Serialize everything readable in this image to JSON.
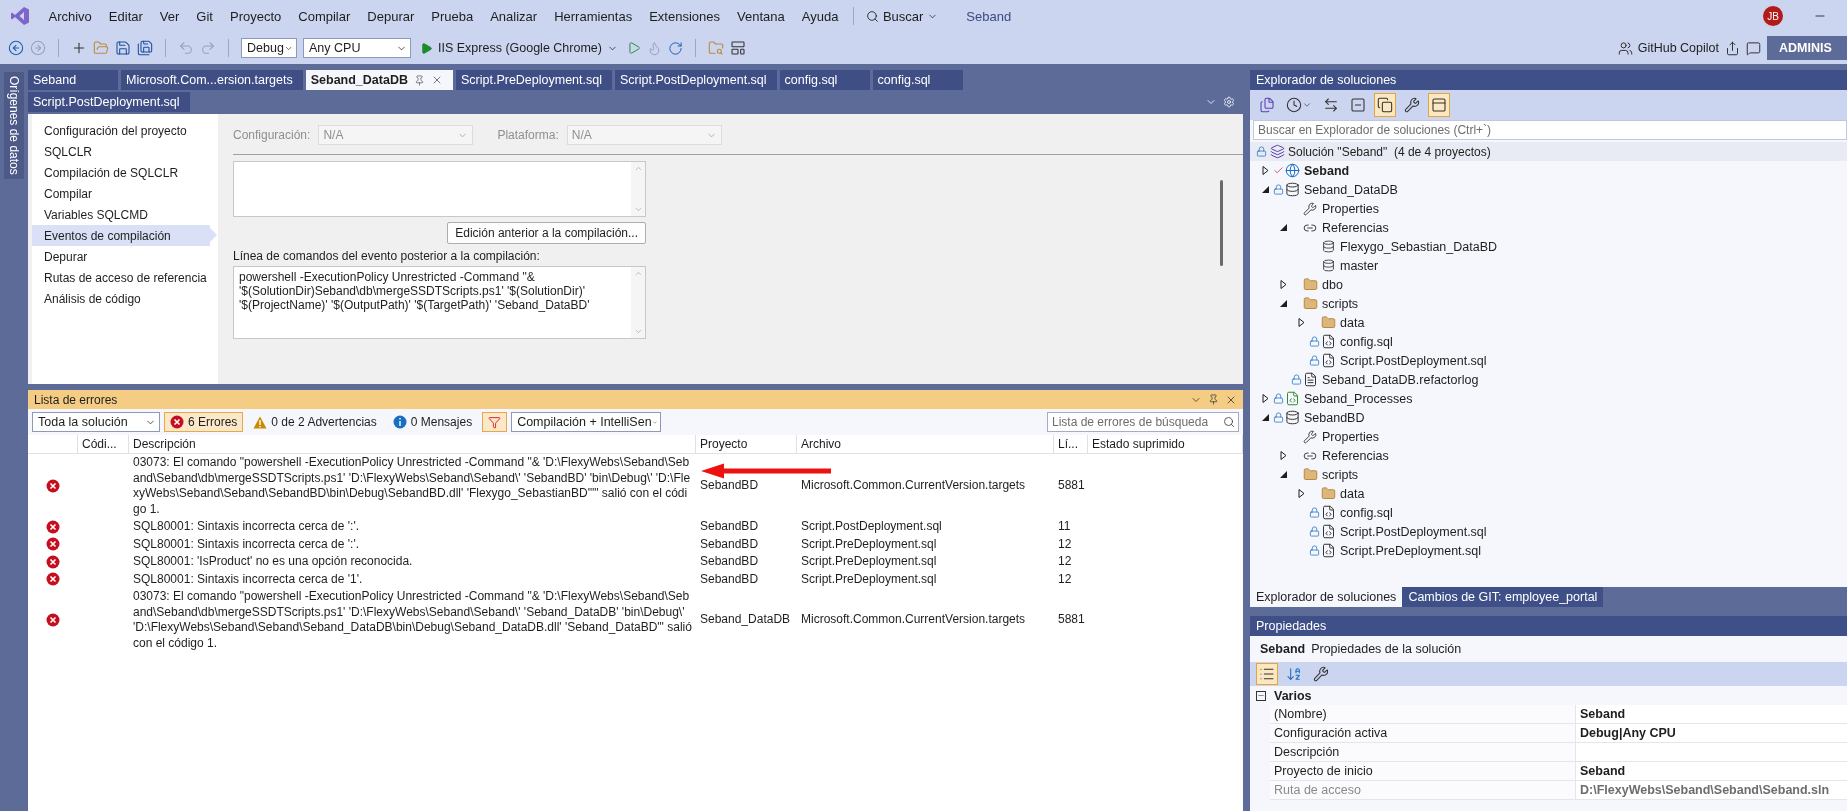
{
  "menu": {
    "items": [
      "Archivo",
      "Editar",
      "Ver",
      "Git",
      "Proyecto",
      "Compilar",
      "Depurar",
      "Prueba",
      "Analizar",
      "Herramientas",
      "Extensiones",
      "Ventana",
      "Ayuda"
    ],
    "search": "Buscar",
    "title": "Seband",
    "avatar": "JB"
  },
  "toolbar": {
    "configuration": "Debug",
    "platform": "Any CPU",
    "run_target": "IIS Express (Google Chrome)",
    "copilot": "GitHub Copilot",
    "account": "ADMINIS"
  },
  "side_strip": {
    "label": "Orígenes de datos"
  },
  "document_tabs": [
    [
      {
        "label": "Seband",
        "selected": false
      },
      {
        "label": "Microsoft.Com...ersion.targets",
        "selected": false
      },
      {
        "label": "Seband_DataDB",
        "selected": true
      },
      {
        "label": "Script.PreDeployment.sql",
        "selected": false
      },
      {
        "label": "Script.PostDeployment.sql",
        "selected": false
      },
      {
        "label": "config.sql",
        "selected": false
      },
      {
        "label": "config.sql",
        "selected": false
      }
    ],
    [
      {
        "label": "Script.PostDeployment.sql",
        "selected": false
      }
    ]
  ],
  "project_properties": {
    "nav": [
      {
        "label": "Configuración del proyecto",
        "selected": false
      },
      {
        "label": "SQLCLR",
        "selected": false
      },
      {
        "label": "Compilación de SQLCLR",
        "selected": false
      },
      {
        "label": "Compilar",
        "selected": false
      },
      {
        "label": "Variables SQLCMD",
        "selected": false
      },
      {
        "label": "Eventos de compilación",
        "selected": true
      },
      {
        "label": "Depurar",
        "selected": false
      },
      {
        "label": "Rutas de acceso de referencia",
        "selected": false
      },
      {
        "label": "Análisis de código",
        "selected": false
      }
    ],
    "configuration_label": "Configuración:",
    "configuration": "N/A",
    "platform_label": "Plataforma:",
    "platform": "N/A",
    "pre_build_button": "Edición anterior a la compilación...",
    "post_build_label": "Línea de comandos del evento posterior a la compilación:",
    "post_build_command": "powershell -ExecutionPolicy Unrestricted -Command \"& '$(SolutionDir)Seband\\db\\mergeSSDTScripts.ps1' '$(SolutionDir)' '$(ProjectName)' '$(OutputPath)' '$(TargetPath)' 'Seband_DataBD'"
  },
  "error_list": {
    "title": "Lista de errores",
    "scope": "Toda la solución",
    "filters": [
      {
        "kind": "error",
        "label": "6 Errores",
        "selected": true
      },
      {
        "kind": "warning",
        "label": "0 de 2 Advertencias",
        "selected": false
      },
      {
        "kind": "info",
        "label": "0 Mensajes",
        "selected": false
      }
    ],
    "filter_button": {
      "selected": true
    },
    "source": "Compilación + IntelliSen",
    "search_placeholder": "Lista de errores de búsqueda",
    "columns": [
      "Códi...",
      "Descripción",
      "Proyecto",
      "Archivo",
      "Lí...",
      "Estado suprimido"
    ],
    "rows": [
      {
        "kind": "error",
        "description": "03073: El comando \"powershell -ExecutionPolicy Unrestricted -Command \"& 'D:\\FlexyWebs\\Seband\\Seband\\Seband\\db\\mergeSSDTScripts.ps1' 'D:\\FlexyWebs\\Seband\\Seband\\' 'SebandBD' 'bin\\Debug\\' 'D:\\FlexyWebs\\Seband\\Seband\\SebandBD\\bin\\Debug\\SebandBD.dll' 'Flexygo_SebastianBD'\"\" salió con el código 1.",
        "project": "SebandBD",
        "file": "Microsoft.Common.CurrentVersion.targets",
        "line": "5881",
        "annotated": true
      },
      {
        "kind": "error",
        "description": "SQL80001: Sintaxis incorrecta cerca de ':'.",
        "project": "SebandBD",
        "file": "Script.PostDeployment.sql",
        "line": "11",
        "annotated": false
      },
      {
        "kind": "error",
        "description": "SQL80001: Sintaxis incorrecta cerca de ':'.",
        "project": "SebandBD",
        "file": "Script.PreDeployment.sql",
        "line": "12",
        "annotated": false
      },
      {
        "kind": "error",
        "description": "SQL80001: 'IsProduct' no es una opción reconocida.",
        "project": "SebandBD",
        "file": "Script.PreDeployment.sql",
        "line": "12",
        "annotated": false
      },
      {
        "kind": "error",
        "description": "SQL80001: Sintaxis incorrecta cerca de '1'.",
        "project": "SebandBD",
        "file": "Script.PreDeployment.sql",
        "line": "12",
        "annotated": false
      },
      {
        "kind": "error",
        "description": "03073: El comando \"powershell -ExecutionPolicy Unrestricted -Command \"& 'D:\\FlexyWebs\\Seband\\Seband\\Seband\\db\\mergeSSDTScripts.ps1' 'D:\\FlexyWebs\\Seband\\Seband\\' 'Seband_DataDB' 'bin\\Debug\\' 'D:\\FlexyWebs\\Seband\\Seband\\Seband_DataDB\\bin\\Debug\\Seband_DataDB.dll' 'Seband_DataBD'\" salió con el código 1.",
        "project": "Seband_DataDB",
        "file": "Microsoft.Common.CurrentVersion.targets",
        "line": "5881",
        "annotated": false
      }
    ]
  },
  "solution_explorer": {
    "title": "Explorador de soluciones",
    "toolbar": [
      {
        "kind": "switch-views",
        "selected": false
      },
      {
        "kind": "pending-changes",
        "selected": false
      },
      {
        "kind": "sync",
        "selected": false
      },
      {
        "kind": "collapse-all",
        "selected": false
      },
      {
        "kind": "show-all-files",
        "selected": true
      },
      {
        "kind": "properties",
        "selected": false
      },
      {
        "kind": "preview",
        "selected": true
      }
    ],
    "search_placeholder": "Buscar en Explorador de soluciones (Ctrl+`)",
    "solution": "Solución \"Seband\"  (4 de 4 proyectos)",
    "tree": [
      {
        "label": "Seband",
        "kind": "web-project",
        "edited": true,
        "locked": false,
        "startup": true,
        "expanded": false
      },
      {
        "label": "Seband_DataDB",
        "kind": "db-project",
        "edited": false,
        "locked": true,
        "startup": false,
        "expanded": true,
        "children": [
          {
            "label": "Properties",
            "kind": "properties",
            "edited": false,
            "locked": false
          },
          {
            "label": "Referencias",
            "kind": "references",
            "edited": false,
            "locked": false,
            "expanded": true,
            "children": [
              {
                "label": "Flexygo_Sebastian_DataBD",
                "kind": "reference",
                "edited": false,
                "locked": false
              },
              {
                "label": "master",
                "kind": "reference",
                "edited": false,
                "locked": false
              }
            ]
          },
          {
            "label": "dbo",
            "kind": "folder",
            "edited": false,
            "locked": false,
            "expanded": false
          },
          {
            "label": "scripts",
            "kind": "folder",
            "edited": false,
            "locked": false,
            "expanded": true,
            "children": [
              {
                "label": "data",
                "kind": "folder",
                "edited": false,
                "locked": false,
                "expanded": false
              },
              {
                "label": "config.sql",
                "kind": "sql",
                "edited": false,
                "locked": true
              },
              {
                "label": "Script.PostDeployment.sql",
                "kind": "sql",
                "edited": false,
                "locked": true
              }
            ]
          },
          {
            "label": "Seband_DataDB.refactorlog",
            "kind": "refactorlog",
            "edited": false,
            "locked": true
          }
        ]
      },
      {
        "label": "Seband_Processes",
        "kind": "csharp-project",
        "edited": false,
        "locked": true,
        "startup": false,
        "expanded": false
      },
      {
        "label": "SebandBD",
        "kind": "db-project",
        "edited": false,
        "locked": true,
        "startup": false,
        "expanded": true,
        "children": [
          {
            "label": "Properties",
            "kind": "properties",
            "edited": false,
            "locked": false
          },
          {
            "label": "Referencias",
            "kind": "references",
            "edited": false,
            "locked": false,
            "expanded": false
          },
          {
            "label": "scripts",
            "kind": "folder",
            "edited": false,
            "locked": false,
            "expanded": true,
            "children": [
              {
                "label": "data",
                "kind": "folder",
                "edited": false,
                "locked": false,
                "expanded": false
              },
              {
                "label": "config.sql",
                "kind": "sql",
                "edited": false,
                "locked": true
              },
              {
                "label": "Script.PostDeployment.sql",
                "kind": "sql",
                "edited": false,
                "locked": true
              },
              {
                "label": "Script.PreDeployment.sql",
                "kind": "sql",
                "edited": false,
                "locked": true
              }
            ]
          }
        ]
      }
    ],
    "bottom_tabs": [
      {
        "label": "Explorador de soluciones",
        "selected": true
      },
      {
        "label": "Cambios de GIT: employee_portal",
        "selected": false
      }
    ]
  },
  "properties": {
    "title": "Propiedades",
    "object_name": "Seband",
    "object_type": "Propiedades de la solución",
    "toolbar": [
      {
        "kind": "categorized",
        "selected": true
      },
      {
        "kind": "alphabetical",
        "selected": false
      },
      {
        "kind": "property-pages",
        "selected": false
      }
    ],
    "category": {
      "label": "Varios",
      "expanded": true
    },
    "rows": [
      {
        "name": "(Nombre)",
        "value": "Seband",
        "disabled": false
      },
      {
        "name": "Configuración activa",
        "value": "Debug|Any CPU",
        "disabled": false
      },
      {
        "name": "Descripción",
        "disabled": false
      },
      {
        "name": "Proyecto de inicio",
        "value": "Seband",
        "disabled": false
      },
      {
        "name": "Ruta de acceso",
        "value": "D:\\FlexyWebs\\Seband\\Seband\\Seband.sln",
        "disabled": true
      }
    ]
  }
}
